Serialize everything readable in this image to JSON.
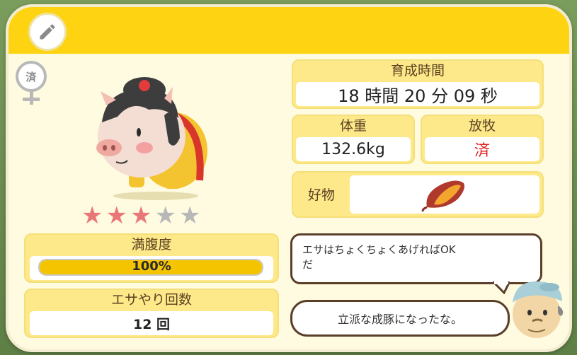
{
  "pig": {
    "shipped_mark": "済",
    "stars": {
      "rating": 3,
      "max": 5,
      "filled_color": "#e87878",
      "empty_color": "#b8b8b8"
    }
  },
  "fullness": {
    "label": "満腹度",
    "value_text": "100%",
    "value": 1.0,
    "fill_color": "#f5c400"
  },
  "feedings": {
    "label": "エサやり回数",
    "value": "12 回"
  },
  "growth_time": {
    "label": "育成時間",
    "value": "18 時間 20 分 09 秒"
  },
  "weight": {
    "label": "体重",
    "value": "132.6kg"
  },
  "grazing": {
    "label": "放牧",
    "value": "済",
    "value_color": "#e02020"
  },
  "favorite": {
    "label": "好物",
    "icon": "sweet-potato-icon"
  },
  "speech": {
    "hint": "エサはちょくちょくあげればOK\nだ",
    "comment": "立派な成豚になったな。"
  },
  "colors": {
    "header": "#fdd312",
    "card": "#fffbe0",
    "panel": "#fde98a"
  }
}
